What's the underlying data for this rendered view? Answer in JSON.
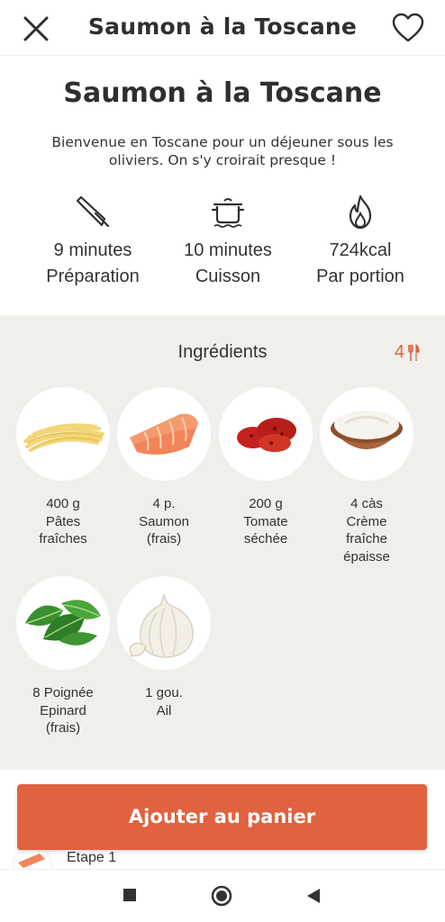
{
  "header": {
    "title": "Saumon à la Toscane"
  },
  "recipe": {
    "title": "Saumon à la Toscane",
    "description": "Bienvenue en Toscane pour un déjeuner sous les oliviers. On s'y croirait presque !"
  },
  "stats": [
    {
      "icon": "knife-icon",
      "value": "9 minutes",
      "label": "Préparation"
    },
    {
      "icon": "cooking-pot-icon",
      "value": "10 minutes",
      "label": "Cuisson"
    },
    {
      "icon": "flame-icon",
      "value": "724kcal",
      "label": "Par portion"
    }
  ],
  "ingredients": {
    "title": "Ingrédients",
    "servings": "4",
    "items": [
      {
        "qty": "400 g",
        "name": "Pâtes\nfraîches"
      },
      {
        "qty": "4 p.",
        "name": "Saumon\n(frais)"
      },
      {
        "qty": "200 g",
        "name": "Tomate\nséchée"
      },
      {
        "qty": "4 càs",
        "name": "Crème\nfraîche\népaisse"
      },
      {
        "qty": "8 Poignée",
        "name": "Epinard\n(frais)"
      },
      {
        "qty": "1 gou.",
        "name": "Ail"
      }
    ]
  },
  "cta": {
    "label": "Ajouter au panier"
  },
  "steps": {
    "first_label": "Etape 1"
  },
  "colors": {
    "accent": "#e0623f",
    "section_bg": "#f1efec",
    "text": "#333333"
  }
}
